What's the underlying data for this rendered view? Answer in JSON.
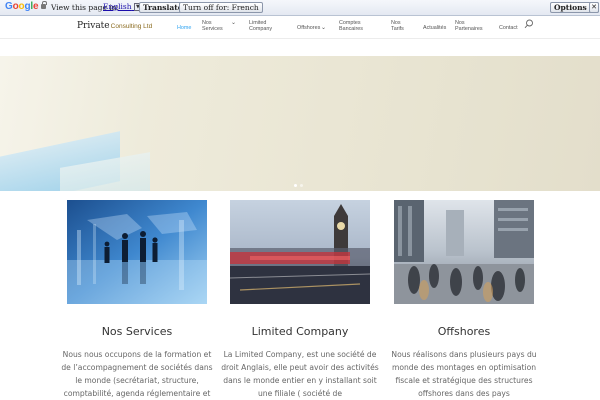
{
  "translate_bar": {
    "logo": "Google",
    "prompt": "View this page in:",
    "language": "English",
    "translate_label": "Translate",
    "turn_off_label": "Turn off for: French",
    "options_label": "Options ▼",
    "close_label": "✕"
  },
  "header": {
    "logo_main": "Private",
    "logo_sub": "Consulting Ltd",
    "nav": [
      {
        "lines": [
          "Home"
        ],
        "active": true
      },
      {
        "lines": [
          "Nos",
          "Services"
        ],
        "dropdown": true
      },
      {
        "lines": [
          "Limited",
          "Company"
        ]
      },
      {
        "lines": [
          "Offshores"
        ],
        "dropdown": true
      },
      {
        "lines": [
          "Comptes",
          "Bancaires"
        ]
      },
      {
        "lines": [
          "Nos",
          "Tarifs"
        ]
      },
      {
        "lines": [
          "Actualités"
        ]
      },
      {
        "lines": [
          "Nos",
          "Partenaires"
        ]
      },
      {
        "lines": [
          "Contact"
        ]
      }
    ]
  },
  "cards": [
    {
      "title": "Nos Services",
      "text": "Nous nous occupons de la formation et de l’accompagnement de sociétés dans le monde (secrétariat, structure, comptabilité, agenda réglementaire et"
    },
    {
      "title": "Limited Company",
      "text": "La Limited Company, est une société de droit Anglais, elle peut avoir des activités dans le monde entier en y installant soit une filiale ( société de"
    },
    {
      "title": "Offshores",
      "text": "Nous réalisons dans plusieurs pays du monde des montages en optimisation fiscale et stratégique des structures offshores dans des pays"
    }
  ],
  "colors": {
    "accent": "#2ea3f2",
    "logo_sub": "#8a6a1e",
    "text": "#666666"
  }
}
